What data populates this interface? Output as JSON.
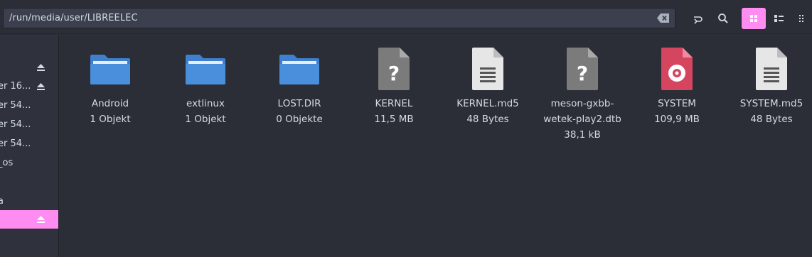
{
  "path": "/run/media/user/LIBREELEC",
  "toolbar": {
    "buttons": [
      {
        "name": "go-up-icon"
      },
      {
        "name": "search-icon"
      },
      {
        "name": "grid-view-icon",
        "active": true
      },
      {
        "name": "list-view-icon"
      },
      {
        "name": "compact-view-icon"
      }
    ]
  },
  "sidebar": {
    "items": [
      {
        "label": "",
        "eject": true
      },
      {
        "label": "er 16...",
        "eject": true
      },
      {
        "label": "er 54...",
        "eject": false
      },
      {
        "label": "er 54...",
        "eject": false
      },
      {
        "label": "er 54...",
        "eject": false
      },
      {
        "label": "_os",
        "eject": false
      },
      {
        "label": "a",
        "eject": false
      },
      {
        "label": "",
        "eject": true,
        "active": true
      }
    ]
  },
  "files": [
    {
      "name": "Android",
      "meta": "1 Objekt",
      "icon": "folder"
    },
    {
      "name": "extlinux",
      "meta": "1 Objekt",
      "icon": "folder"
    },
    {
      "name": "LOST.DIR",
      "meta": "0 Objekte",
      "icon": "folder"
    },
    {
      "name": "KERNEL",
      "meta": "11,5 MB",
      "icon": "unknown"
    },
    {
      "name": "KERNEL.md5",
      "meta": "48 Bytes",
      "icon": "text"
    },
    {
      "name": "meson-gxbb-",
      "name2": "wetek-play2.dtb",
      "meta": "38,1 kB",
      "icon": "unknown"
    },
    {
      "name": "SYSTEM",
      "meta": "109,9 MB",
      "icon": "disc-image"
    },
    {
      "name": "SYSTEM.md5",
      "meta": "48 Bytes",
      "icon": "text"
    }
  ],
  "colors": {
    "accent": "#ff8cf0",
    "folder": "#4a8fdc",
    "disc": "#d6455f",
    "background": "#2b2e37"
  }
}
